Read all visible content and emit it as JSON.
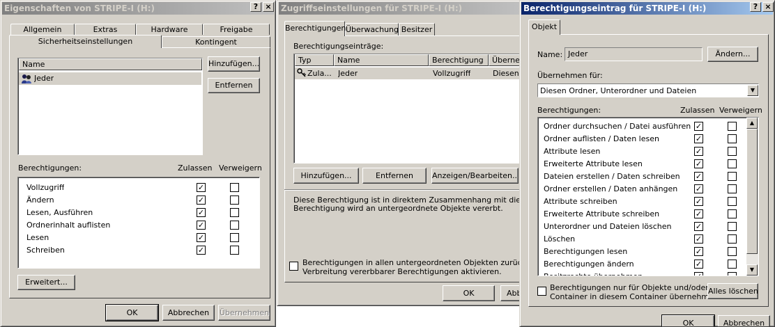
{
  "win1": {
    "title": "Eigenschaften von STRIPE-I (H:)",
    "help": "?",
    "close": "×",
    "tabs_row1": [
      "Allgemein",
      "Extras",
      "Hardware",
      "Freigabe"
    ],
    "tabs_row2": [
      "Sicherheitseinstellungen",
      "Kontingent"
    ],
    "users_header": "Name",
    "users": [
      "Jeder"
    ],
    "add_btn": "Hinzufügen...",
    "remove_btn": "Entfernen",
    "perm_label": "Berechtigungen:",
    "allow_label": "Zulassen",
    "deny_label": "Verweigern",
    "permissions": [
      {
        "name": "Vollzugriff",
        "allow": true,
        "deny": false
      },
      {
        "name": "Ändern",
        "allow": true,
        "deny": false
      },
      {
        "name": "Lesen, Ausführen",
        "allow": true,
        "deny": false
      },
      {
        "name": "Ordnerinhalt auflisten",
        "allow": true,
        "deny": false
      },
      {
        "name": "Lesen",
        "allow": true,
        "deny": false
      },
      {
        "name": "Schreiben",
        "allow": true,
        "deny": false
      }
    ],
    "advanced_btn": "Erweitert...",
    "ok": "OK",
    "cancel": "Abbrechen",
    "apply": "Übernehmen"
  },
  "win2": {
    "title": "Zugriffseinstellungen für STRIPE-I (H:)",
    "tabs": [
      "Berechtigungen",
      "Überwachung",
      "Besitzer"
    ],
    "entries_label": "Berechtigungseinträge:",
    "columns": [
      "Typ",
      "Name",
      "Berechtigung",
      "Übernem"
    ],
    "entries": [
      {
        "type": "Zula...",
        "name": "Jeder",
        "perm": "Vollzugriff",
        "inherit": "Diesen O"
      }
    ],
    "add_btn": "Hinzufügen...",
    "remove_btn": "Entfernen",
    "view_btn": "Anzeigen/Bearbeiten...",
    "info_line1": "Diese Berechtigung ist in direktem Zusammenhang mit diesem Objekt",
    "info_line2": "Berechtigung wird an untergeordnete Objekte vererbt.",
    "reset_line1": "Berechtigungen in allen untergeordneten Objekten zurücksetzen u",
    "reset_line2": "Verbreitung vererbbarer Berechtigungen aktivieren.",
    "ok": "OK",
    "cancel": "Abb"
  },
  "win3": {
    "title": "Berechtigungseintrag für STRIPE-I (H:)",
    "help": "?",
    "close": "×",
    "tab": "Objekt",
    "name_label": "Name:",
    "name_value": "Jeder",
    "change_btn": "Ändern...",
    "apply_to_label": "Übernehmen für:",
    "apply_to_value": "Diesen Ordner, Unterordner und Dateien",
    "perm_label": "Berechtigungen:",
    "allow_label": "Zulassen",
    "deny_label": "Verweigern",
    "permissions": [
      {
        "name": "Ordner durchsuchen / Datei ausführen",
        "allow": true,
        "deny": false
      },
      {
        "name": "Ordner auflisten / Daten lesen",
        "allow": true,
        "deny": false
      },
      {
        "name": "Attribute lesen",
        "allow": true,
        "deny": false
      },
      {
        "name": "Erweiterte Attribute lesen",
        "allow": true,
        "deny": false
      },
      {
        "name": "Dateien erstellen / Daten schreiben",
        "allow": true,
        "deny": false
      },
      {
        "name": "Ordner erstellen / Daten anhängen",
        "allow": true,
        "deny": false
      },
      {
        "name": "Attribute schreiben",
        "allow": true,
        "deny": false
      },
      {
        "name": "Erweiterte Attribute schreiben",
        "allow": true,
        "deny": false
      },
      {
        "name": "Unterordner und Dateien löschen",
        "allow": true,
        "deny": false
      },
      {
        "name": "Löschen",
        "allow": true,
        "deny": false
      },
      {
        "name": "Berechtigungen lesen",
        "allow": true,
        "deny": false
      },
      {
        "name": "Berechtigungen ändern",
        "allow": true,
        "deny": false
      },
      {
        "name": "Besitzrechte übernehmen",
        "allow": true,
        "deny": false
      }
    ],
    "only_line1": "Berechtigungen nur für Objekte und/oder",
    "only_line2": "Container in diesem Container übernehmen",
    "clear_btn": "Alles löschen",
    "ok": "OK",
    "cancel": "Abbrechen"
  }
}
